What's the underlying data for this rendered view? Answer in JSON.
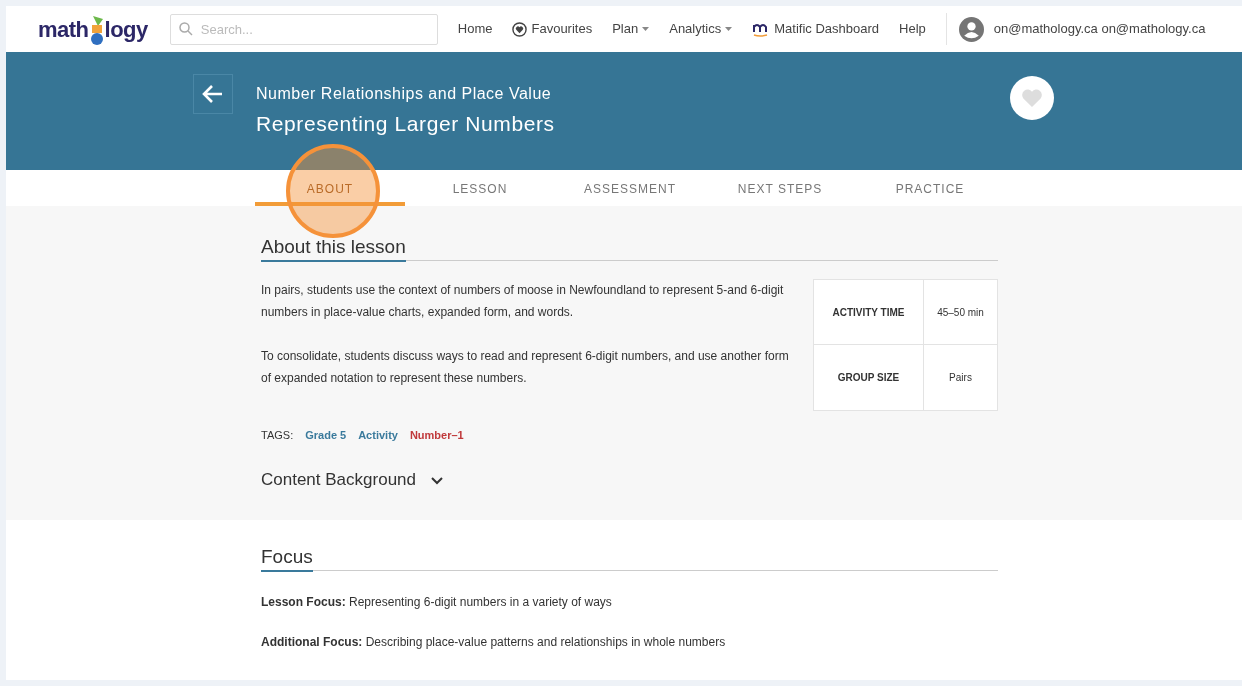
{
  "navbar": {
    "logo": {
      "text_before": "math",
      "text_after": "logy"
    },
    "search": {
      "placeholder": "Search..."
    },
    "links": [
      {
        "label": "Home",
        "kind": "plain"
      },
      {
        "label": "Favourites",
        "kind": "heart"
      },
      {
        "label": "Plan",
        "kind": "dropdown"
      },
      {
        "label": "Analytics",
        "kind": "dropdown"
      },
      {
        "label": "Matific Dashboard",
        "kind": "matific"
      },
      {
        "label": "Help",
        "kind": "plain"
      }
    ],
    "user": "on@mathology.ca on@mathology.ca"
  },
  "header": {
    "subtitle": "Number Relationships and Place Value",
    "title": "Representing Larger Numbers",
    "favourite": false
  },
  "tabs": [
    {
      "label": "ABOUT",
      "selected": true
    },
    {
      "label": "LESSON",
      "selected": false
    },
    {
      "label": "ASSESSMENT",
      "selected": false
    },
    {
      "label": "NEXT STEPS",
      "selected": false
    },
    {
      "label": "PRACTICE",
      "selected": false
    }
  ],
  "about": {
    "heading": "About this lesson",
    "paragraphs": [
      "In pairs, students use the context of numbers of moose in Newfoundland to represent 5-and 6-digit numbers in place-value charts, expanded form, and words.",
      "To consolidate, students discuss ways to read and represent 6-digit numbers, and use another form of expanded notation to represent these numbers."
    ],
    "info": [
      {
        "label": "ACTIVITY TIME",
        "value": "45–50 min"
      },
      {
        "label": "GROUP SIZE",
        "value": "Pairs"
      }
    ],
    "tags_label": "TAGS:",
    "tags": [
      {
        "label": "Grade 5",
        "color": "#3a7a9c"
      },
      {
        "label": "Activity",
        "color": "#3a7a9c"
      },
      {
        "label": "Number–1",
        "color": "#c0393b"
      }
    ],
    "content_background": {
      "label": "Content Background",
      "expanded": false
    }
  },
  "focus": {
    "heading": "Focus",
    "items": [
      "**Lesson Focus:** Representing 6-digit numbers in a variety of ways",
      "**Additional Focus:** Describing place-value patterns and relationships in whole numbers"
    ]
  }
}
